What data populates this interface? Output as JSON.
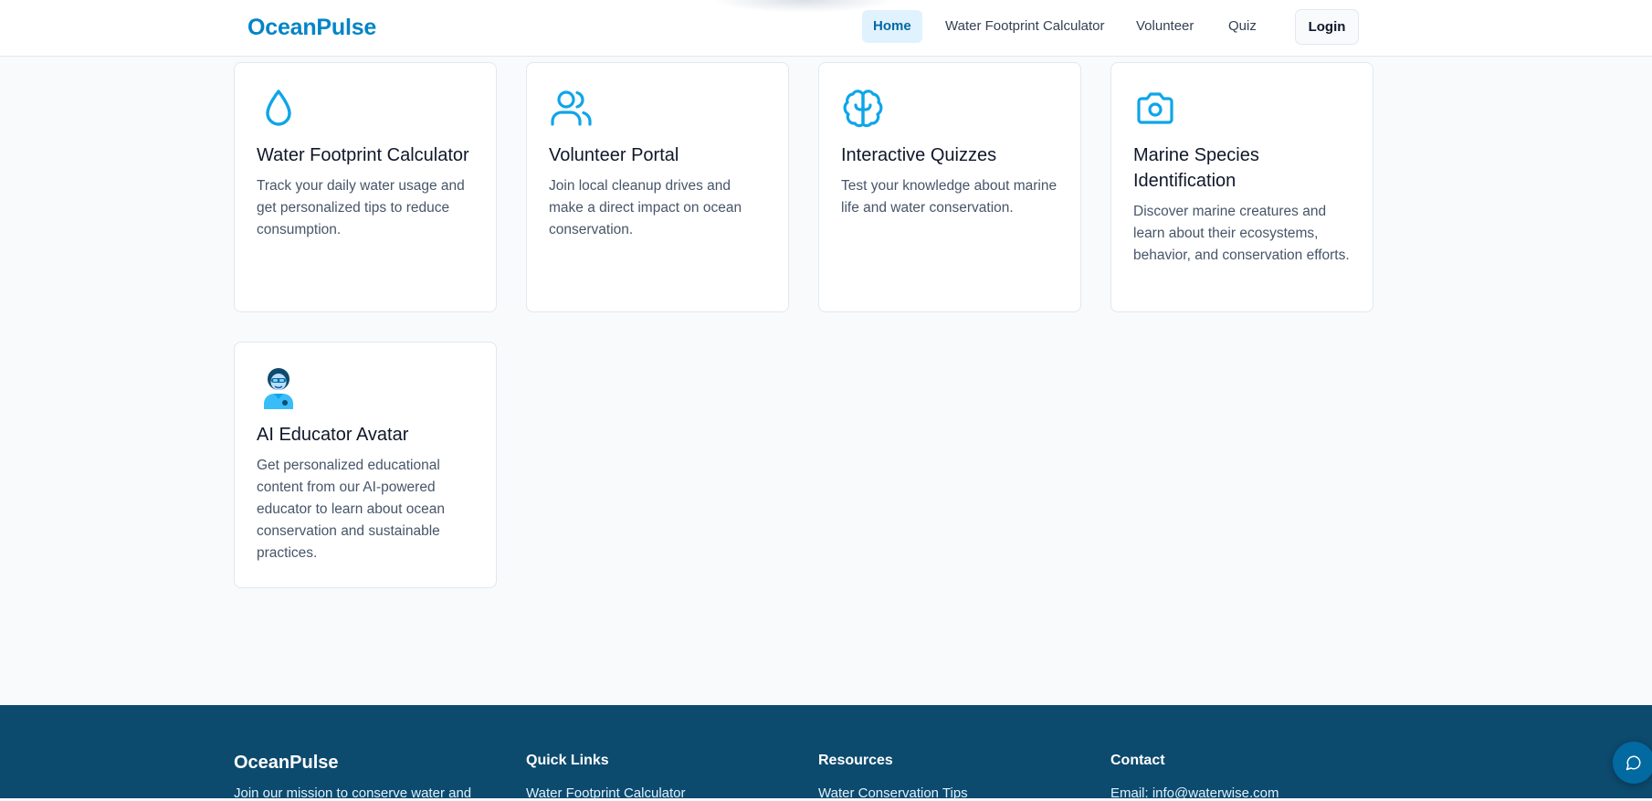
{
  "header": {
    "brand": "OceanPulse",
    "nav": [
      {
        "label": "Home",
        "active": true
      },
      {
        "label": "Water Footprint Calculator",
        "active": false
      },
      {
        "label": "Volunteer",
        "active": false
      },
      {
        "label": "Quiz",
        "active": false
      }
    ],
    "login_label": "Login"
  },
  "cards": [
    {
      "icon": "water-drop-icon",
      "title": "Water Footprint Calculator",
      "description": "Track your daily water usage and get personalized tips to reduce consumption."
    },
    {
      "icon": "users-icon",
      "title": "Volunteer Portal",
      "description": "Join local cleanup drives and make a direct impact on ocean conservation."
    },
    {
      "icon": "brain-icon",
      "title": "Interactive Quizzes",
      "description": "Test your knowledge about marine life and water conservation."
    },
    {
      "icon": "camera-icon",
      "title": "Marine Species Identification",
      "description": "Discover marine creatures and learn about their ecosystems, behavior, and conservation efforts."
    },
    {
      "icon": "ai-educator-avatar-icon",
      "title": "AI Educator Avatar",
      "description": "Get personalized educational content from our AI-powered educator to learn about ocean conservation and sustainable practices."
    }
  ],
  "footer": {
    "brand": "OceanPulse",
    "tagline": "Join our mission to conserve water and",
    "columns": [
      {
        "heading": "Quick Links",
        "first_link": "Water Footprint Calculator"
      },
      {
        "heading": "Resources",
        "first_link": "Water Conservation Tips"
      },
      {
        "heading": "Contact",
        "first_link": "Email: info@waterwise.com"
      }
    ]
  },
  "chat_button": {
    "icon": "chat-bubble-icon"
  },
  "colors": {
    "brand": "#0284c7",
    "icon_accent": "#0ea5e9",
    "footer_bg": "#0c4a6e",
    "nav_active_bg": "#e0f2fe"
  }
}
